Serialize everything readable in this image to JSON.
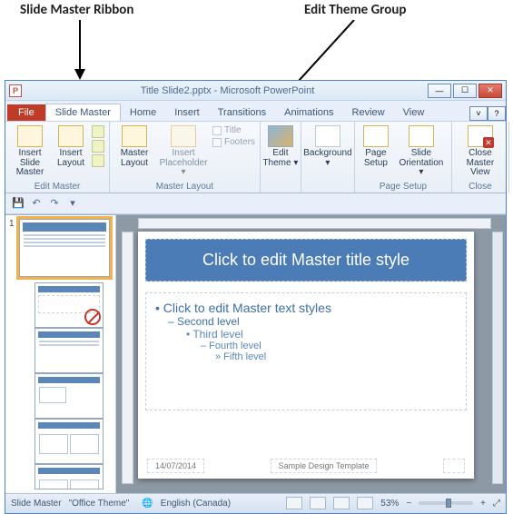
{
  "annotations": {
    "ribbon_label": "Slide Master Ribbon",
    "theme_label": "Edit Theme Group"
  },
  "window": {
    "title": "Title Slide2.pptx - Microsoft PowerPoint"
  },
  "tabs": {
    "file": "File",
    "slide_master": "Slide Master",
    "home": "Home",
    "insert": "Insert",
    "transitions": "Transitions",
    "animations": "Animations",
    "review": "Review",
    "view": "View"
  },
  "ribbon": {
    "insert_slide_master": "Insert Slide Master",
    "insert_layout": "Insert Layout",
    "edit_master_group": "Edit Master",
    "master_layout": "Master Layout",
    "insert_placeholder": "Insert Placeholder ▾",
    "title_chk": "Title",
    "footers_chk": "Footers",
    "master_layout_group": "Master Layout",
    "edit_theme": "Edit Theme ▾",
    "background": "Background ▾",
    "page_setup": "Page Setup",
    "slide_orientation": "Slide Orientation ▾",
    "page_setup_group": "Page Setup",
    "close_master_view": "Close Master View",
    "close_group": "Close"
  },
  "slide": {
    "title": "Click to edit Master title style",
    "b1": "• Click to edit Master text styles",
    "b2": "– Second level",
    "b3": "• Third level",
    "b4": "– Fourth level",
    "b5": "» Fifth level",
    "date": "14/07/2014",
    "footer": "Sample Design Template"
  },
  "status": {
    "mode": "Slide Master",
    "theme": "\"Office Theme\"",
    "lang": "English (Canada)",
    "zoom": "53%"
  }
}
